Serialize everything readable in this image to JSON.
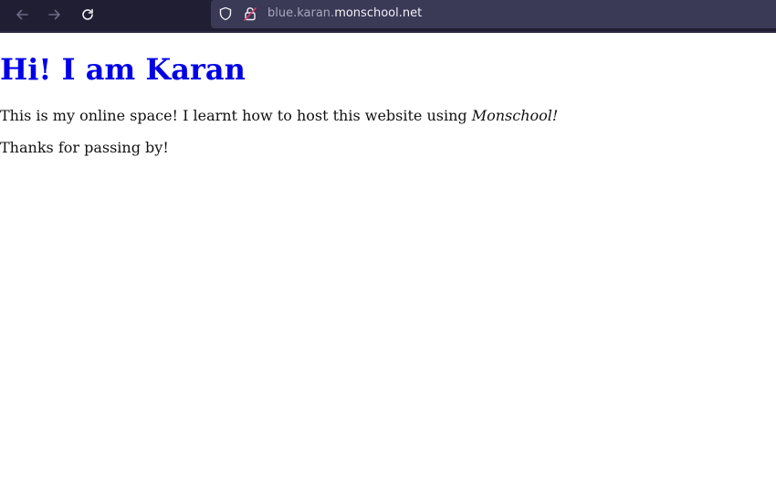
{
  "browser": {
    "url_subdomain": "blue.karan.",
    "url_domain": "monschool.net",
    "icons": {
      "back": "arrow-left-icon",
      "forward": "arrow-right-icon",
      "reload": "reload-icon",
      "shield": "shield-icon",
      "lock": "lock-icon"
    },
    "colors": {
      "toolbar_bg": "#1f1e33",
      "urlbar_bg": "#3a3956"
    }
  },
  "page": {
    "heading": "Hi! I am Karan",
    "intro_text": "This is my online space! I learnt how to host this website using ",
    "intro_emphasis": "Monschool!",
    "thanks": "Thanks for passing by!",
    "colors": {
      "heading": "#0000e6",
      "body_text": "#111111"
    }
  }
}
